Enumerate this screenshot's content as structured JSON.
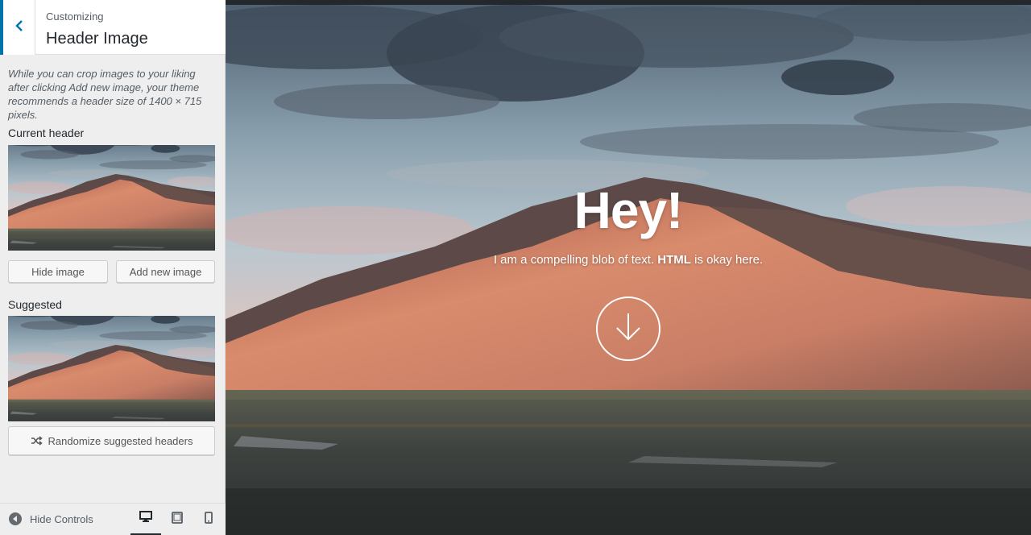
{
  "header": {
    "subtitle": "Customizing",
    "title": "Header Image"
  },
  "description": "While you can crop images to your liking after clicking Add new image, your theme recommends a header size of 1400 × 715 pixels.",
  "current_header": {
    "label": "Current header",
    "hide_button": "Hide image",
    "add_button": "Add new image"
  },
  "suggested": {
    "label": "Suggested",
    "randomize_button": "Randomize suggested headers"
  },
  "footer": {
    "hide_controls": "Hide Controls",
    "devices": [
      "desktop-icon",
      "tablet-icon",
      "mobile-icon"
    ],
    "active_device": "desktop"
  },
  "hero": {
    "title": "Hey!",
    "text_before": "I am a compelling blob of text. ",
    "text_bold": "HTML",
    "text_after": " is okay here."
  },
  "colors": {
    "accent": "#0073aa",
    "sidebar_bg": "#eeeeee"
  }
}
